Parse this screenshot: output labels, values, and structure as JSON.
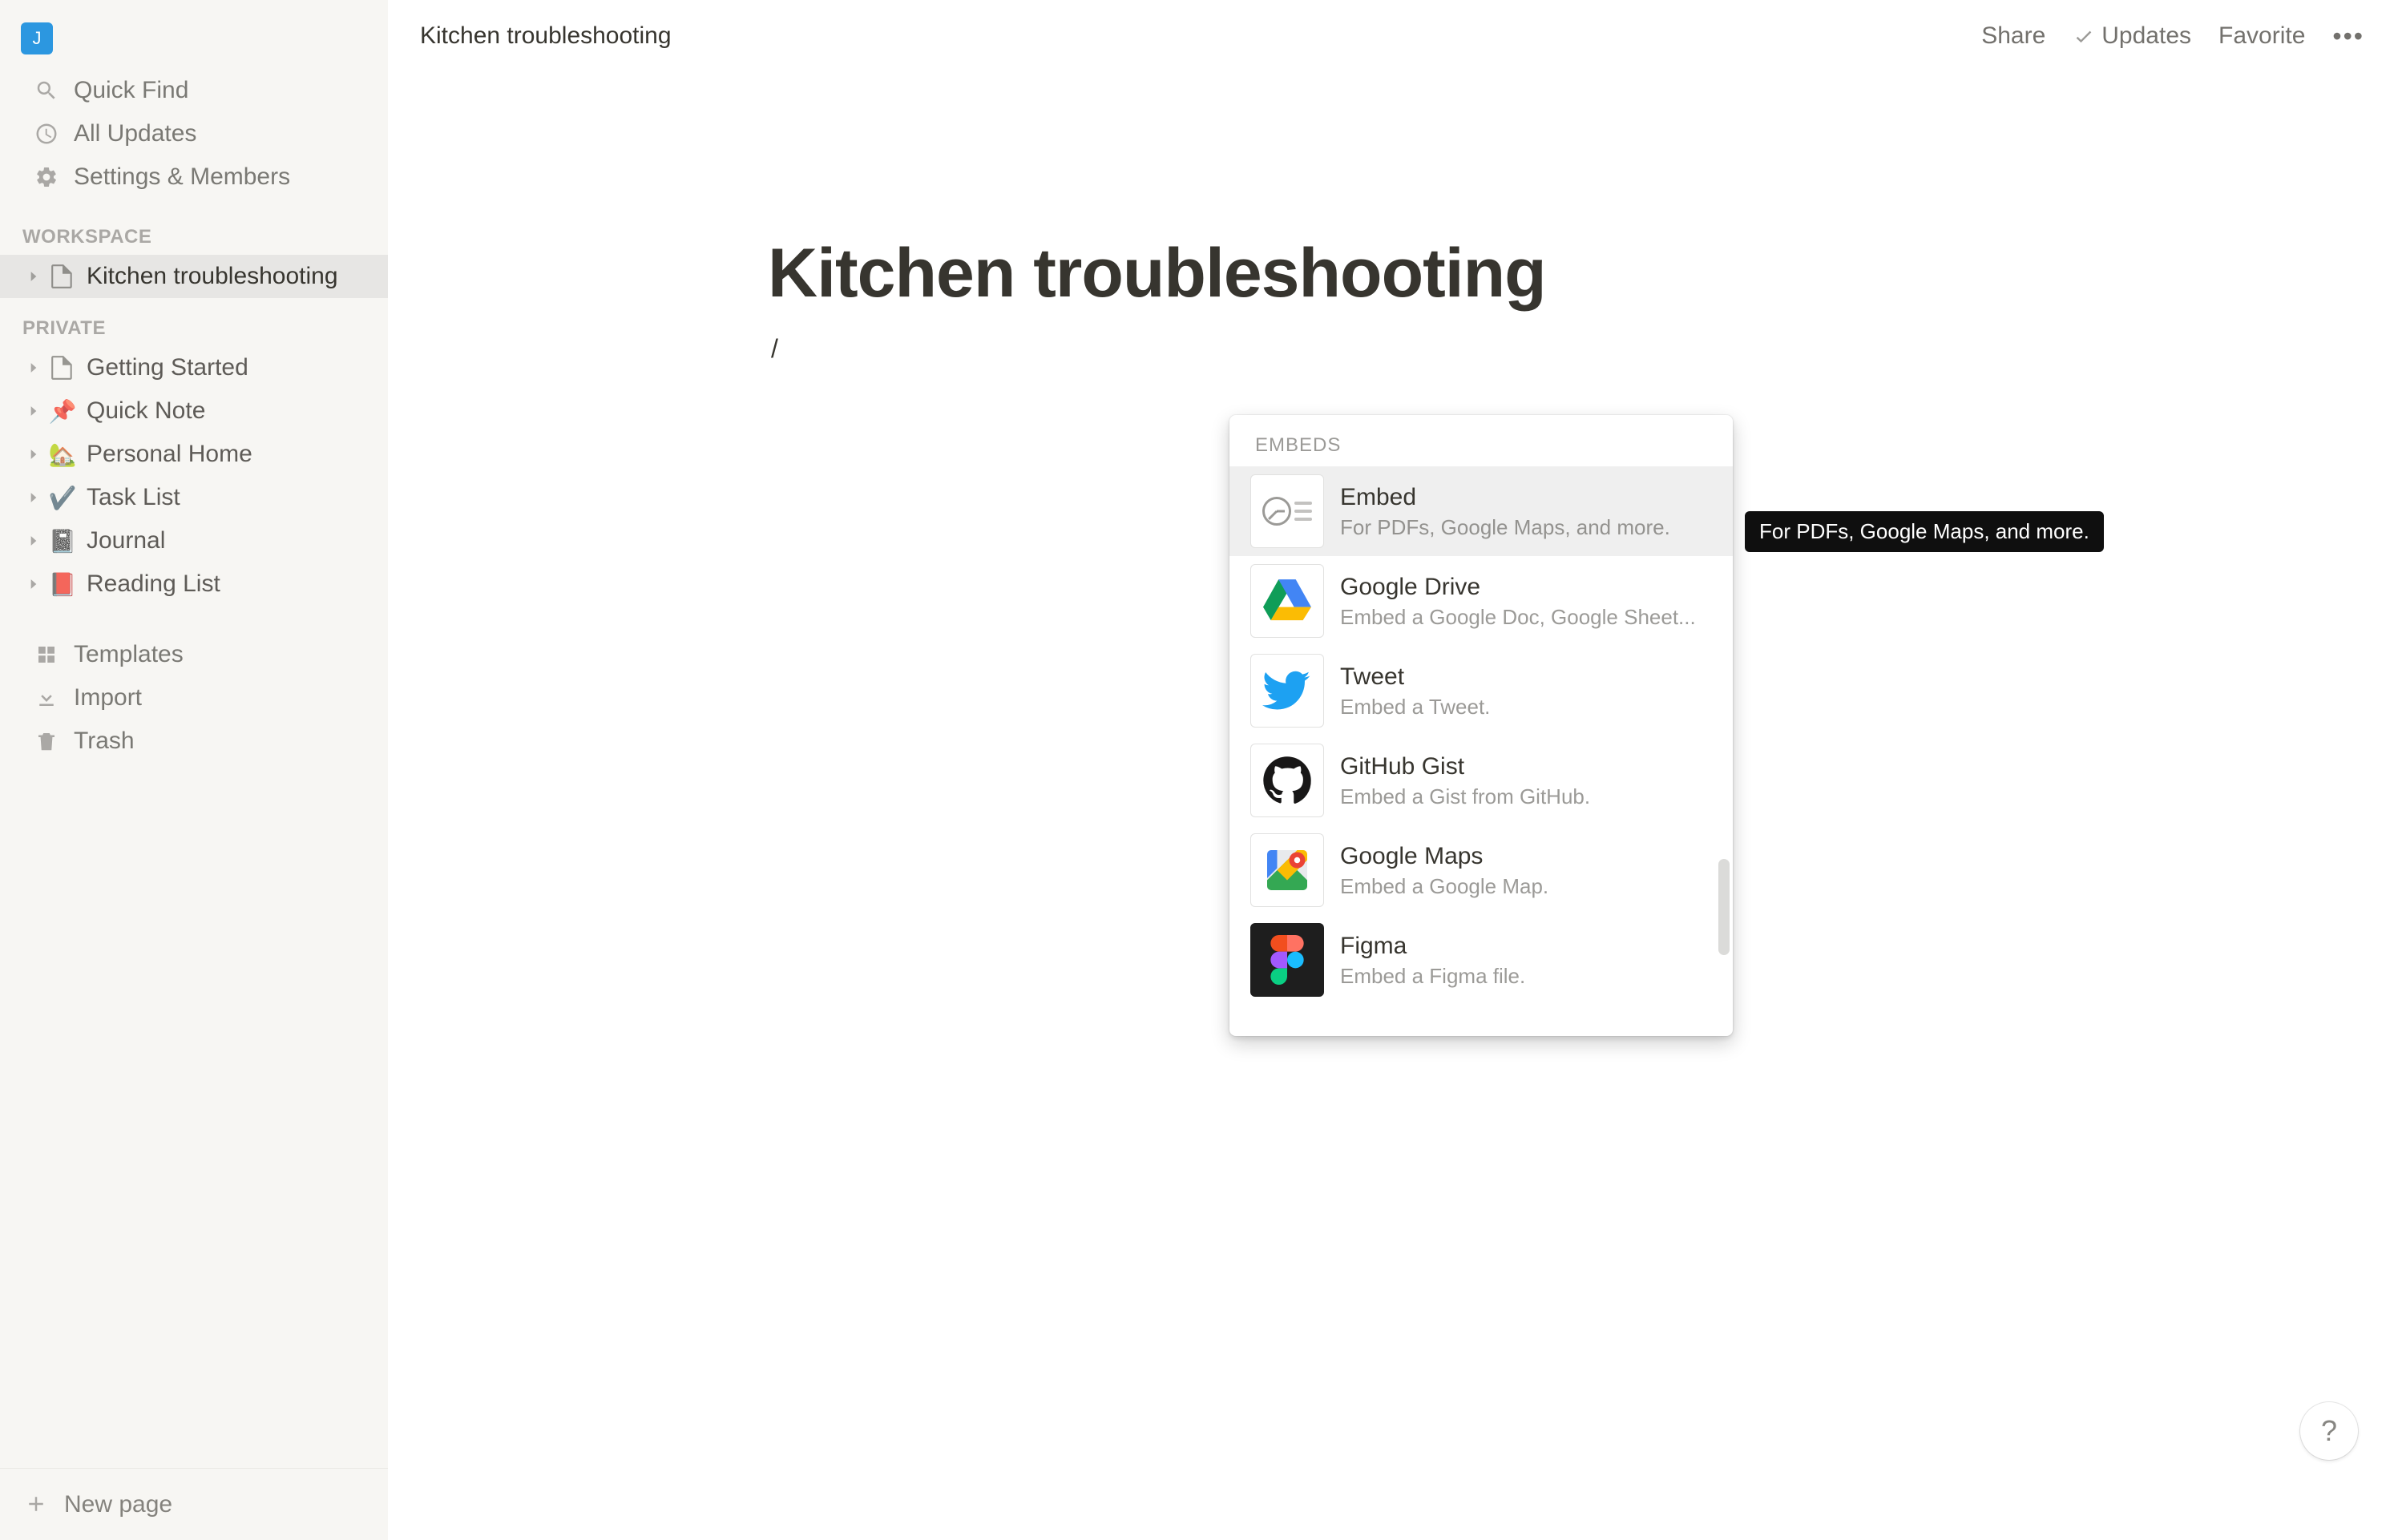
{
  "workspace_badge": "J",
  "sidebar": {
    "quick_find": "Quick Find",
    "all_updates": "All Updates",
    "settings": "Settings & Members",
    "section_workspace": "WORKSPACE",
    "section_private": "PRIVATE",
    "workspace_pages": [
      {
        "label": "Kitchen troubleshooting",
        "icon": "page",
        "active": true
      }
    ],
    "private_pages": [
      {
        "label": "Getting Started",
        "icon": "page"
      },
      {
        "label": "Quick Note",
        "icon": "📌"
      },
      {
        "label": "Personal Home",
        "icon": "🏡"
      },
      {
        "label": "Task List",
        "icon": "✔️"
      },
      {
        "label": "Journal",
        "icon": "📓"
      },
      {
        "label": "Reading List",
        "icon": "📕"
      }
    ],
    "templates": "Templates",
    "import": "Import",
    "trash": "Trash",
    "new_page": "New page"
  },
  "topbar": {
    "breadcrumb": "Kitchen troubleshooting",
    "share": "Share",
    "updates": "Updates",
    "favorite": "Favorite"
  },
  "page": {
    "title": "Kitchen troubleshooting",
    "typed": "/"
  },
  "slash_menu": {
    "section_label": "EMBEDS",
    "items": [
      {
        "title": "Embed",
        "desc": "For PDFs, Google Maps, and more.",
        "icon": "embed",
        "selected": true
      },
      {
        "title": "Google Drive",
        "desc": "Embed a Google Doc, Google Sheet...",
        "icon": "gdrive"
      },
      {
        "title": "Tweet",
        "desc": "Embed a Tweet.",
        "icon": "twitter"
      },
      {
        "title": "GitHub Gist",
        "desc": "Embed a Gist from GitHub.",
        "icon": "github"
      },
      {
        "title": "Google Maps",
        "desc": "Embed a Google Map.",
        "icon": "gmaps"
      },
      {
        "title": "Figma",
        "desc": "Embed a Figma file.",
        "icon": "figma"
      }
    ]
  },
  "tooltip": "For PDFs, Google Maps, and more.",
  "help": "?"
}
